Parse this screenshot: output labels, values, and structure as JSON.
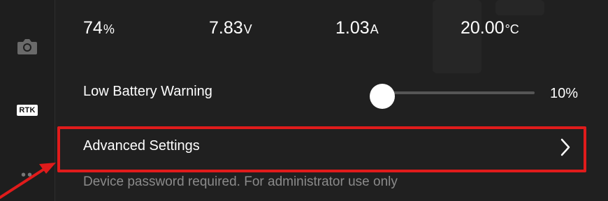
{
  "sidebar": {
    "icons": [
      "camera-icon",
      "rtk-icon",
      "more-icon"
    ],
    "rtk_label": "RTK",
    "more_glyph": "••"
  },
  "stats": {
    "battery_percent": {
      "value": "74",
      "unit": "%"
    },
    "voltage": {
      "value": "7.83",
      "unit": "V"
    },
    "current": {
      "value": "1.03",
      "unit": "A"
    },
    "temperature": {
      "value": "20.00",
      "unit": "°C"
    }
  },
  "low_battery_warning": {
    "label": "Low Battery Warning",
    "value_text": "10%",
    "value": 10
  },
  "advanced_settings": {
    "label": "Advanced Settings"
  },
  "footnote": "Device password required. For administrator use only",
  "colors": {
    "highlight": "#e01b1b",
    "background": "#202020",
    "text": "#ffffff",
    "muted_text": "#8a8a8a"
  }
}
